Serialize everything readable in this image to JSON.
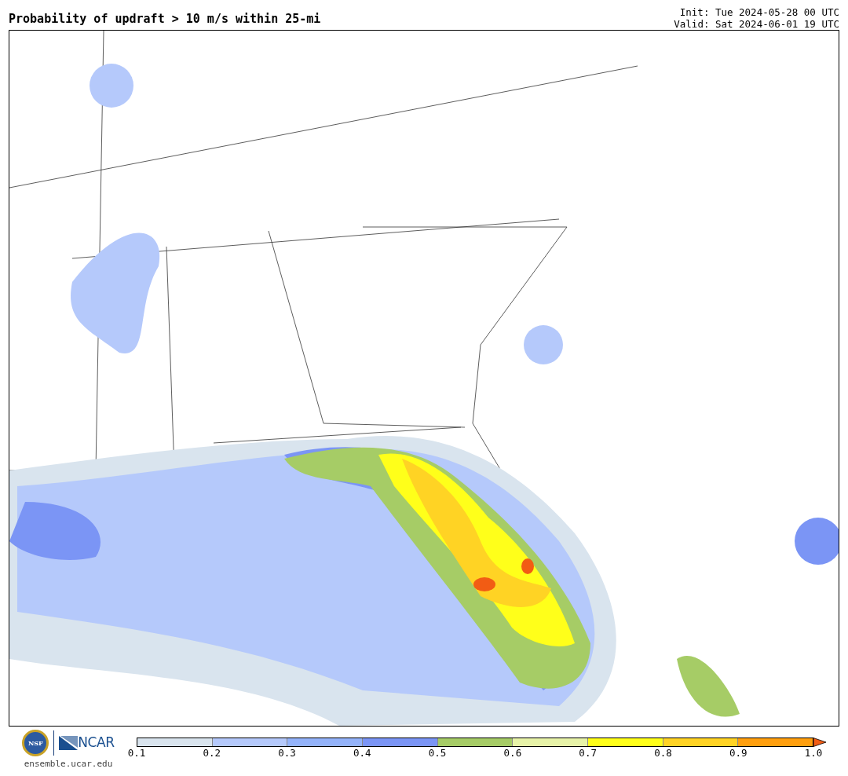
{
  "title": "Probability of updraft > 10 m/s within 25-mi",
  "init": "Init: Tue 2024-05-28 00 UTC",
  "valid": "Valid: Sat 2024-06-01 19 UTC",
  "logos": {
    "nsf": "NSF",
    "ncar": "NCAR",
    "site": "ensemble.ucar.edu"
  },
  "colorbar": {
    "segments": [
      {
        "color": "#d9e4ee"
      },
      {
        "color": "#b5c9fb"
      },
      {
        "color": "#94b3fa"
      },
      {
        "color": "#7b95f5"
      },
      {
        "color": "#a6cc66"
      },
      {
        "color": "#e7f3a8"
      },
      {
        "color": "#ffff1a"
      },
      {
        "color": "#ffd324"
      },
      {
        "color": "#ff9f0f"
      },
      {
        "kind": "arrow",
        "color": "#f25c14"
      }
    ],
    "ticks": [
      "0.1",
      "0.2",
      "0.3",
      "0.4",
      "0.5",
      "0.6",
      "0.7",
      "0.8",
      "0.9",
      "1.0"
    ]
  }
}
